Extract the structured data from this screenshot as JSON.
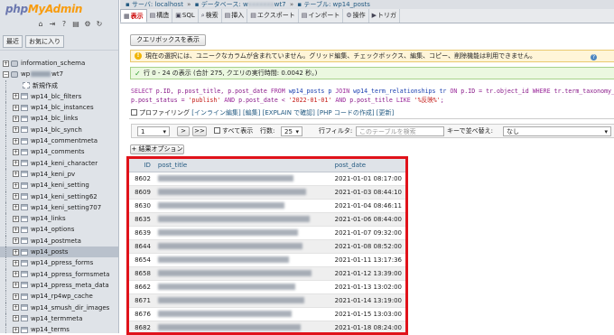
{
  "app": {
    "logo_prefix": "php",
    "logo_suffix": "MyAdmin",
    "nav_tabs": [
      "最近",
      "お気に入り"
    ]
  },
  "tree": {
    "items": [
      {
        "label": "information_schema",
        "kind": "db",
        "indent": 0,
        "expander": "+"
      },
      {
        "label": "wp",
        "label_tail": "wt7",
        "kind": "db",
        "indent": 0,
        "expander": "−"
      },
      {
        "label": "新規作成",
        "kind": "new",
        "indent": 1
      },
      {
        "label": "wp14_blc_filters",
        "kind": "table",
        "indent": 1,
        "expander": "+"
      },
      {
        "label": "wp14_blc_instances",
        "kind": "table",
        "indent": 1,
        "expander": "+"
      },
      {
        "label": "wp14_blc_links",
        "kind": "table",
        "indent": 1,
        "expander": "+"
      },
      {
        "label": "wp14_blc_synch",
        "kind": "table",
        "indent": 1,
        "expander": "+"
      },
      {
        "label": "wp14_commentmeta",
        "kind": "table",
        "indent": 1,
        "expander": "+"
      },
      {
        "label": "wp14_comments",
        "kind": "table",
        "indent": 1,
        "expander": "+"
      },
      {
        "label": "wp14_keni_character",
        "kind": "table",
        "indent": 1,
        "expander": "+"
      },
      {
        "label": "wp14_keni_pv",
        "kind": "table",
        "indent": 1,
        "expander": "+"
      },
      {
        "label": "wp14_keni_setting",
        "kind": "table",
        "indent": 1,
        "expander": "+"
      },
      {
        "label": "wp14_keni_setting62",
        "kind": "table",
        "indent": 1,
        "expander": "+"
      },
      {
        "label": "wp14_keni_setting707",
        "kind": "table",
        "indent": 1,
        "expander": "+"
      },
      {
        "label": "wp14_links",
        "kind": "table",
        "indent": 1,
        "expander": "+"
      },
      {
        "label": "wp14_options",
        "kind": "table",
        "indent": 1,
        "expander": "+"
      },
      {
        "label": "wp14_postmeta",
        "kind": "table",
        "indent": 1,
        "expander": "+"
      },
      {
        "label": "wp14_posts",
        "kind": "table",
        "indent": 1,
        "expander": "+",
        "selected": true
      },
      {
        "label": "wp14_ppress_forms",
        "kind": "table",
        "indent": 1,
        "expander": "+"
      },
      {
        "label": "wp14_ppress_formsmeta",
        "kind": "table",
        "indent": 1,
        "expander": "+"
      },
      {
        "label": "wp14_ppress_meta_data",
        "kind": "table",
        "indent": 1,
        "expander": "+"
      },
      {
        "label": "wp14_rp4wp_cache",
        "kind": "table",
        "indent": 1,
        "expander": "+"
      },
      {
        "label": "wp14_smush_dir_images",
        "kind": "table",
        "indent": 1,
        "expander": "+"
      },
      {
        "label": "wp14_termmeta",
        "kind": "table",
        "indent": 1,
        "expander": "+"
      },
      {
        "label": "wp14_terms",
        "kind": "table",
        "indent": 1,
        "expander": "+"
      }
    ]
  },
  "breadcrumb": {
    "server_label": "サーバ:",
    "server_value": "localhost",
    "db_label": "データベース:",
    "db_visible": "w",
    "db_hidden": "xxxxxxx",
    "db_tail": "wt7",
    "table_label": "テーブル:",
    "table_value": "wp14_posts"
  },
  "tabs": [
    {
      "label": "表示",
      "icon": "▦",
      "active": true
    },
    {
      "label": "構造",
      "icon": "▤"
    },
    {
      "label": "SQL",
      "icon": "▣"
    },
    {
      "label": "検索",
      "icon": "⌕"
    },
    {
      "label": "挿入",
      "icon": "▤"
    },
    {
      "label": "エクスポート",
      "icon": "▤"
    },
    {
      "label": "インポート",
      "icon": "▤"
    },
    {
      "label": "操作",
      "icon": "⚙"
    },
    {
      "label": "トリガ",
      "icon": "▶"
    }
  ],
  "main": {
    "clipboard_button": "クエリボックスを表示",
    "notice_text": "現在の選択には、ユニークなカラムが含まれていません。グリッド編集、チェックボックス、編集、コピー、削除機能は利用できません。",
    "notice_icon": "!",
    "notice_help": "?",
    "success_text": "行 0 - 24 の表示 (合計 275, クエリの実行時間: 0.0042 秒。)",
    "success_icon": "✓",
    "sql_line1_parts": [
      {
        "t": "SELECT ",
        "c": "kw"
      },
      {
        "t": "p.ID, p.post_title, p.post_date ",
        "c": ""
      },
      {
        "t": "FROM ",
        "c": "kw"
      },
      {
        "t": "wp14_posts p ",
        "c": "id"
      },
      {
        "t": "JOIN ",
        "c": "kw"
      },
      {
        "t": "wp14_term_relationships tr ",
        "c": "id"
      },
      {
        "t": "ON ",
        "c": "kw"
      },
      {
        "t": "p.ID = tr.object_id ",
        "c": ""
      },
      {
        "t": "WHERE ",
        "c": "kw"
      },
      {
        "t": "tr.term_taxonomy_id = 33",
        "c": ""
      }
    ],
    "sql_line2_parts": [
      {
        "t": "p.post_status = ",
        "c": ""
      },
      {
        "t": "'publish' ",
        "c": "str"
      },
      {
        "t": "AND ",
        "c": "kw"
      },
      {
        "t": "p.post_date < ",
        "c": ""
      },
      {
        "t": "'2022-01-01' ",
        "c": "str"
      },
      {
        "t": "AND ",
        "c": "kw"
      },
      {
        "t": "p.post_title ",
        "c": ""
      },
      {
        "t": "LIKE ",
        "c": "kw"
      },
      {
        "t": "'%反映%'",
        "c": "str"
      },
      {
        "t": ";",
        "c": ""
      }
    ],
    "profiling_label": "プロファイリング",
    "sql_links": [
      "[インライン編集]",
      "[編集]",
      "[EXPLAIN で確認]",
      "[PHP コードの作成]",
      "[更新]"
    ],
    "pager": {
      "page_value": "1",
      "next": ">",
      "last": ">>",
      "show_all": "すべて表示",
      "rows_label": "行数:",
      "rows_value": "25",
      "filter_label": "行フィルタ:",
      "filter_placeholder": "このテーブルを検索",
      "sort_label": "キーで並べ替え:",
      "sort_value": "なし"
    },
    "extra_options": "+ 結果オプション"
  },
  "results": {
    "columns": [
      "ID",
      "post_title",
      "post_date"
    ],
    "rows": [
      {
        "id": "8602",
        "date": "2021-01-01 08:17:00",
        "title_blur_width": 150
      },
      {
        "id": "8609",
        "date": "2021-01-03 08:44:10",
        "title_blur_width": 164
      },
      {
        "id": "8630",
        "date": "2021-01-04 08:46:11",
        "title_blur_width": 140
      },
      {
        "id": "8635",
        "date": "2021-01-06 08:44:00",
        "title_blur_width": 168
      },
      {
        "id": "8639",
        "date": "2021-01-07 09:32:00",
        "title_blur_width": 155
      },
      {
        "id": "8644",
        "date": "2021-01-08 08:52:00",
        "title_blur_width": 160
      },
      {
        "id": "8654",
        "date": "2021-01-11 13:17:36",
        "title_blur_width": 145
      },
      {
        "id": "8658",
        "date": "2021-01-12 13:39:00",
        "title_blur_width": 170
      },
      {
        "id": "8662",
        "date": "2021-01-13 13:02:00",
        "title_blur_width": 152
      },
      {
        "id": "8671",
        "date": "2021-01-14 13:19:00",
        "title_blur_width": 162
      },
      {
        "id": "8676",
        "date": "2021-01-15 13:03:00",
        "title_blur_width": 148
      },
      {
        "id": "8682",
        "date": "2021-01-18 08:24:00",
        "title_blur_width": 158
      }
    ]
  },
  "colors": {
    "highlight_frame": "#e0121a",
    "active_tab_text": "#cc0000",
    "link": "#235a81"
  }
}
